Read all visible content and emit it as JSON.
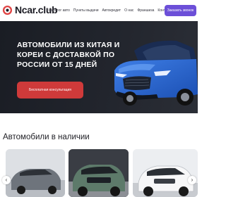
{
  "header": {
    "logo_text": "Ncar.club",
    "nav": [
      "Каталог авто",
      "Пункты выдачи",
      "Автокредит",
      "О нас",
      "Франшиза",
      "Контакты"
    ],
    "cta_label": "Заказать звонок"
  },
  "hero": {
    "title": "Автомобили из Китая и Кореи с доставкой по России от 15 дней",
    "cta_label": "Бесплатная консультация"
  },
  "section": {
    "title": "Автомобили в наличии"
  },
  "icons": {
    "prev": "chevron-left-icon",
    "next": "chevron-right-icon"
  },
  "colors": {
    "accent": "#6c4fd8",
    "hero_cta": "#cf3a3a",
    "hero_bg": "#1d2027"
  }
}
